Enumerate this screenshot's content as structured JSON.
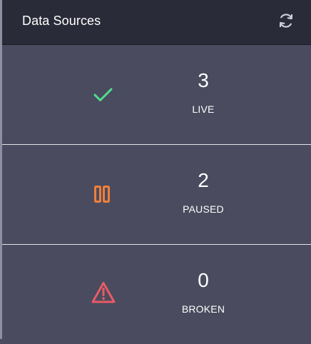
{
  "panel": {
    "title": "Data Sources",
    "refresh_icon": "refresh-icon"
  },
  "stats": [
    {
      "count": "3",
      "label": "LIVE",
      "icon": "check-icon",
      "color": "#4fdf8c"
    },
    {
      "count": "2",
      "label": "PAUSED",
      "icon": "pause-icon",
      "color": "#ef7f3a"
    },
    {
      "count": "0",
      "label": "BROKEN",
      "icon": "warning-icon",
      "color": "#e95b67"
    }
  ],
  "colors": {
    "header_bg": "#2a2b38",
    "body_bg": "#4a4b5e",
    "separator": "#e4e4ea"
  }
}
